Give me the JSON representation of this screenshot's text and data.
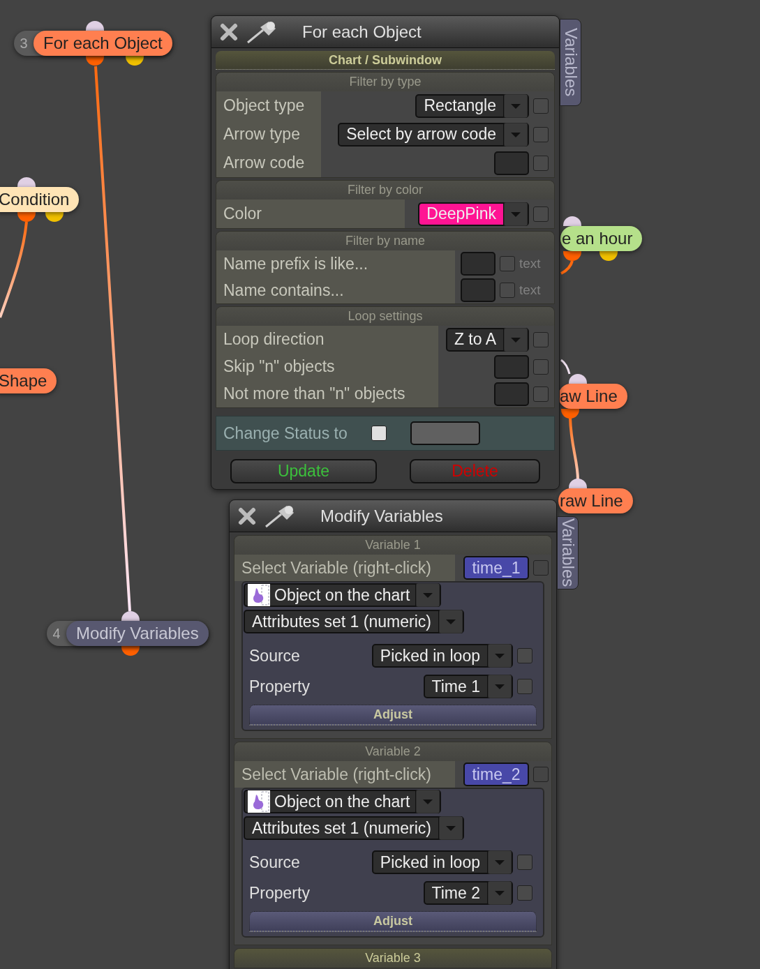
{
  "nodes": [
    {
      "number": "3",
      "label": "For each Object",
      "color": "#ff7f50"
    },
    {
      "label": "Condition",
      "color": "#ffe4b5"
    },
    {
      "label": "Shape",
      "color": "#ff7f50"
    },
    {
      "label": "e an hour",
      "color": "#b5e08a"
    },
    {
      "label": "aw Line",
      "color": "#ff7f50"
    },
    {
      "label": "raw Line",
      "color": "#ff7f50"
    },
    {
      "number": "4",
      "label": "Modify Variables",
      "color": "#585870"
    }
  ],
  "filter_window": {
    "title": "For each Object",
    "side_tab": "Variables",
    "section": "Chart / Subwindow",
    "groups": [
      {
        "title": "Filter by type",
        "rows": [
          {
            "label": "Object type",
            "kind": "dropdown",
            "value": "Rectangle",
            "checked": false
          },
          {
            "label": "Arrow type",
            "kind": "dropdown",
            "value": "Select by arrow code",
            "checked": false
          },
          {
            "label": "Arrow code",
            "kind": "field",
            "checked": false
          }
        ]
      },
      {
        "title": "Filter by color",
        "rows": [
          {
            "label": "Color",
            "kind": "dropdown",
            "value": "DeepPink",
            "color": "#ff1493",
            "checked": false
          }
        ]
      },
      {
        "title": "Filter by name",
        "rows": [
          {
            "label": "Name prefix is like...",
            "kind": "text_field",
            "checked": false,
            "option": "text"
          },
          {
            "label": "Name contains...",
            "kind": "text_field",
            "checked": false,
            "option": "text"
          }
        ]
      },
      {
        "title": "Loop settings",
        "rows": [
          {
            "label": "Loop direction",
            "kind": "dropdown",
            "value": "Z to A",
            "checked": false
          },
          {
            "label": "Skip \"n\" objects",
            "kind": "field",
            "checked": false
          },
          {
            "label": "Not more than \"n\" objects",
            "kind": "field",
            "checked": false
          }
        ]
      }
    ],
    "status": {
      "label": "Change Status to",
      "checked": false
    },
    "buttons": [
      {
        "label": "Update",
        "kind": "update"
      },
      {
        "label": "Delete",
        "kind": "delete"
      }
    ]
  },
  "variables_window": {
    "title": "Modify Variables",
    "side_tab": "Variables",
    "variables": [
      {
        "title": "Variable 1",
        "select_label": "Select Variable (right-click)",
        "variable": "time_1",
        "checked": false,
        "object": "Object on the chart",
        "attributes": "Attributes set 1 (numeric)",
        "fields": [
          {
            "label": "Source",
            "value": "Picked in loop",
            "checked": false
          },
          {
            "label": "Property",
            "value": "Time 1",
            "checked": false
          }
        ],
        "action": "Adjust"
      },
      {
        "title": "Variable 2",
        "select_label": "Select Variable (right-click)",
        "variable": "time_2",
        "checked": false,
        "object": "Object on the chart",
        "attributes": "Attributes set 1 (numeric)",
        "fields": [
          {
            "label": "Source",
            "value": "Picked in loop",
            "checked": false
          },
          {
            "label": "Property",
            "value": "Time 2",
            "checked": false
          }
        ],
        "action": "Adjust"
      },
      {
        "title": "Variable 3"
      }
    ]
  }
}
